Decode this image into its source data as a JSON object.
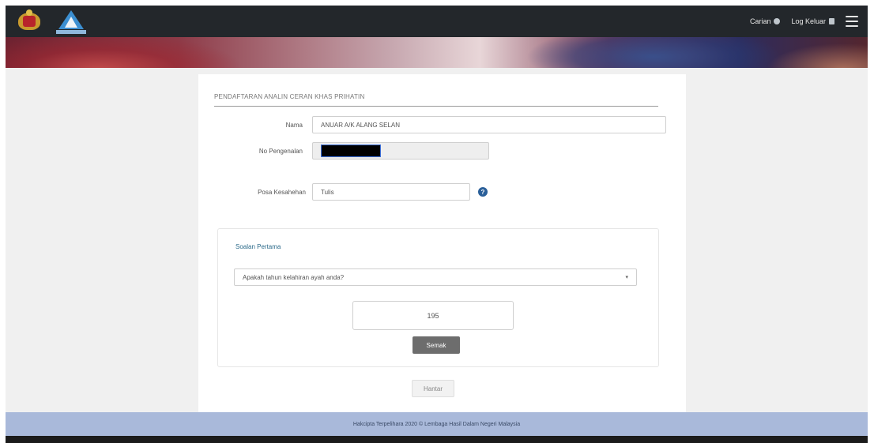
{
  "header": {
    "logos": [
      "malaysia-crest",
      "lhdn-logo"
    ],
    "nav": {
      "help_label": "Carian",
      "logout_label": "Log Keluar"
    }
  },
  "form": {
    "title": "PENDAFTARAN ANALIN CERAN KHAS PRIHATIN",
    "name_label": "Nama",
    "name_value": "ANUAR A/K ALANG SELAN",
    "id_label": "No Pengenalan",
    "id_value": "",
    "password_label": "Posa Kesahehan",
    "password_value": "Tulis",
    "security": {
      "title": "Soalan Pertama",
      "question_selected": "Apakah tahun kelahiran ayah anda?",
      "answer_value": "19⁠5",
      "check_button_label": "Semak"
    },
    "submit_label": "Hantar"
  },
  "footer": {
    "text": "Hakcipta Terpelihara 2020 © Lembaga Hasil Dalam Negeri Malaysia"
  },
  "colors": {
    "topbar": "#23272b",
    "footer": "#a9b9da",
    "help_icon": "#2a5f99",
    "check_button": "#6d6d6d"
  }
}
